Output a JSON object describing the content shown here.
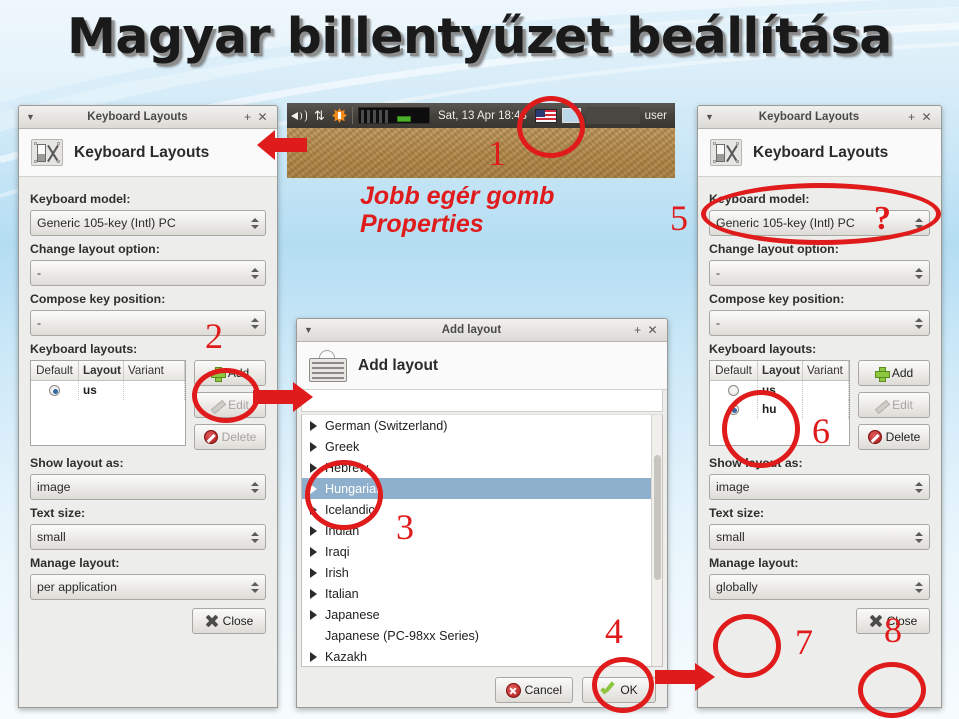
{
  "page": {
    "title": "Magyar billentyűzet beállítása",
    "accent_red": "#e01b1b",
    "background_blue": "#b4ddf2"
  },
  "taskbar": {
    "icons": [
      "volume-icon",
      "network-icon",
      "burst-icon",
      "system-monitor-icon"
    ],
    "clock": "Sat, 13 Apr  18:43",
    "layout_flag": "us-flag-icon",
    "workspace": "workspace-switcher",
    "user": "user"
  },
  "annotations": {
    "note_main": "Jobb egér gomb\nProperties",
    "n1": "1",
    "n2": "2",
    "n3": "3",
    "n4": "4",
    "n5": "5",
    "n6": "6",
    "n7": "7",
    "n8": "8",
    "question": "?"
  },
  "dialog_left": {
    "titlebar": {
      "title": "Keyboard Layouts",
      "menu": "▼",
      "maximize": "+",
      "close": "✕"
    },
    "header": {
      "title": "Keyboard Layouts",
      "icon": "keyboard-layout-icon"
    },
    "fields": [
      {
        "label": "Keyboard model:",
        "value": "Generic 105-key (Intl) PC"
      },
      {
        "label": "Change layout option:",
        "value": "-"
      },
      {
        "label": "Compose key position:",
        "value": "-"
      }
    ],
    "layouts_label": "Keyboard layouts:",
    "table": {
      "columns": [
        "Default",
        "Layout",
        "Variant"
      ],
      "rows": [
        {
          "default": true,
          "layout": "us",
          "variant": ""
        }
      ]
    },
    "buttons": {
      "add": "Add",
      "edit": "Edit",
      "delete": "Delete"
    },
    "fields2": [
      {
        "label": "Show layout as:",
        "value": "image"
      },
      {
        "label": "Text size:",
        "value": "small"
      },
      {
        "label": "Manage layout:",
        "value": "per application"
      }
    ],
    "close_button": "Close"
  },
  "dialog_add": {
    "titlebar": {
      "title": "Add layout",
      "menu": "▼",
      "maximize": "+",
      "close": "✕"
    },
    "header": {
      "title": "Add layout",
      "icon": "keyboard-icon"
    },
    "search_value": "",
    "search_placeholder": "",
    "items": [
      "German (Switzerland)",
      "Greek",
      "Hebrew",
      "Hungarian",
      "Icelandic",
      "Indian",
      "Iraqi",
      "Irish",
      "Italian",
      "Japanese",
      "Japanese (PC-98xx Series)",
      "Kazakh"
    ],
    "selected_item": "Hungarian",
    "expandable": [
      true,
      true,
      true,
      true,
      true,
      true,
      true,
      true,
      true,
      true,
      false,
      true
    ],
    "buttons": {
      "cancel": "Cancel",
      "ok": "OK"
    }
  },
  "dialog_right": {
    "titlebar": {
      "title": "Keyboard Layouts",
      "menu": "▼",
      "maximize": "+",
      "close": "✕"
    },
    "header": {
      "title": "Keyboard Layouts",
      "icon": "keyboard-layout-icon"
    },
    "fields": [
      {
        "label": "Keyboard model:",
        "value": "Generic 105-key (Intl) PC"
      },
      {
        "label": "Change layout option:",
        "value": "-"
      },
      {
        "label": "Compose key position:",
        "value": "-"
      }
    ],
    "layouts_label": "Keyboard layouts:",
    "table": {
      "columns": [
        "Default",
        "Layout",
        "Variant"
      ],
      "rows": [
        {
          "default": false,
          "layout": "us",
          "variant": ""
        },
        {
          "default": true,
          "layout": "hu",
          "variant": ""
        }
      ]
    },
    "buttons": {
      "add": "Add",
      "edit": "Edit",
      "delete": "Delete"
    },
    "fields2": [
      {
        "label": "Show layout as:",
        "value": "image"
      },
      {
        "label": "Text size:",
        "value": "small"
      },
      {
        "label": "Manage layout:",
        "value": "globally"
      }
    ],
    "close_button": "Close"
  }
}
